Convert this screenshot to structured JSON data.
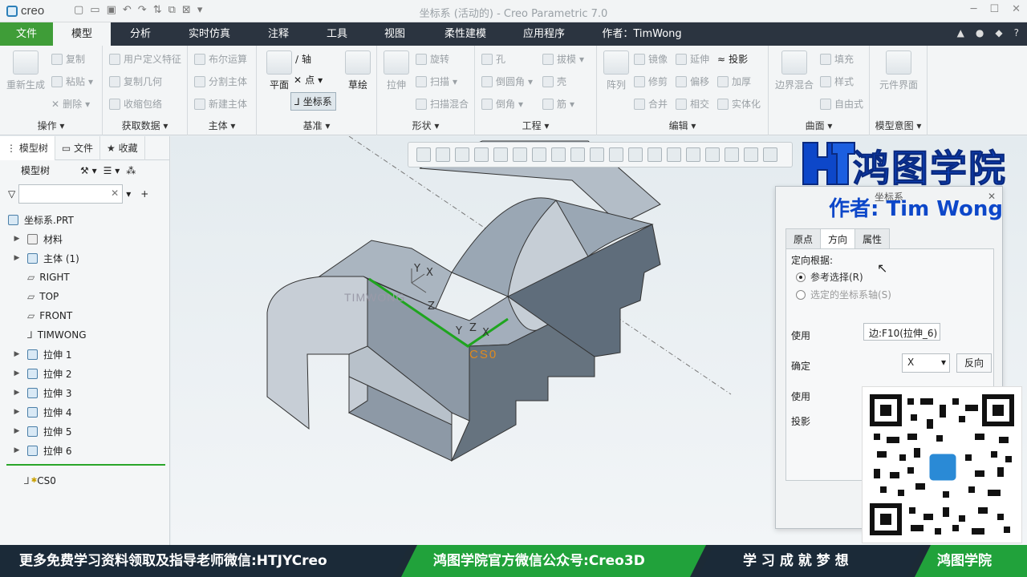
{
  "titlebar": {
    "app": "creo",
    "window_title": "坐标系 (活动的) - Creo Parametric 7.0"
  },
  "tabs": [
    "文件",
    "模型",
    "分析",
    "实时仿真",
    "注释",
    "工具",
    "视图",
    "柔性建模",
    "应用程序",
    "作者：TimWong"
  ],
  "ribbon": {
    "ops": {
      "items": [
        "重新生成",
        "复制",
        "粘贴",
        "删除"
      ],
      "label": "操作"
    },
    "get_data": {
      "items": [
        "用户定义特征",
        "复制几何",
        "收缩包络"
      ],
      "label": "获取数据"
    },
    "body": {
      "items": [
        "布尔运算",
        "分割主体",
        "新建主体"
      ],
      "label": "主体"
    },
    "datum": {
      "items": [
        "平面",
        "轴",
        "点",
        "坐标系",
        "草绘"
      ],
      "label": "基准"
    },
    "shape": {
      "items": [
        "拉伸",
        "旋转",
        "扫描",
        "扫描混合"
      ],
      "label": "形状"
    },
    "eng": {
      "items": [
        "孔",
        "倒圆角",
        "倒角",
        "拔模",
        "壳",
        "筋"
      ],
      "label": "工程"
    },
    "edit": {
      "items": [
        "阵列",
        "镜像",
        "修剪",
        "合并",
        "延伸",
        "偏移",
        "相交",
        "投影",
        "加厚",
        "实体化"
      ],
      "label": "编辑"
    },
    "surface": {
      "items": [
        "边界混合",
        "填充",
        "样式",
        "自由式"
      ],
      "label": "曲面"
    },
    "intent": {
      "items": [
        "元件界面"
      ],
      "label": "模型意图"
    }
  },
  "sidebar": {
    "tabs": [
      "模型树",
      "文件",
      "收藏"
    ],
    "tree_header": "模型树",
    "filter_placeholder": "",
    "nodes": [
      "坐标系.PRT",
      "材料",
      "主体 (1)",
      "RIGHT",
      "TOP",
      "FRONT",
      "TIMWONG",
      "拉伸 1",
      "拉伸 2",
      "拉伸 3",
      "拉伸 4",
      "拉伸 5",
      "拉伸 6"
    ],
    "insert_node": "CS0"
  },
  "viewport": {
    "labels": {
      "timwong": "TIMWONG",
      "cs0": "CS0",
      "y1": "Y",
      "x1": "X",
      "z1": "Z",
      "y2": "Y",
      "z2": "Z",
      "x2": "X"
    }
  },
  "brand": {
    "logo_text": "鸿图学院",
    "author": "作者: Tim Wong"
  },
  "dialog": {
    "title": "坐标系",
    "tabs": [
      "原点",
      "方向",
      "属性"
    ],
    "orient_label": "定向根据:",
    "radio1": "参考选择(R)",
    "radio2": "选定的坐标系轴(S)",
    "use_label1": "使用",
    "use_value1": "边:F10(拉伸_6)",
    "determine_label": "确定",
    "axis_value": "X",
    "flip_button": "反向",
    "use_label2": "使用",
    "project_label": "投影"
  },
  "footer": {
    "seg1": "更多免费学习资料领取及指导老师微信:HTJYCreo",
    "seg2": "鸿图学院官方微信公众号:Creo3D",
    "seg3": "学 习 成 就 梦 想",
    "seg4": "鸿图学院"
  },
  "colors": {
    "file_tab": "#3f9d38",
    "tabbar": "#2b3440",
    "edge_highlight": "#1fa51f",
    "brand_blue": "#0d47c9",
    "footer_green": "#23a23a"
  }
}
